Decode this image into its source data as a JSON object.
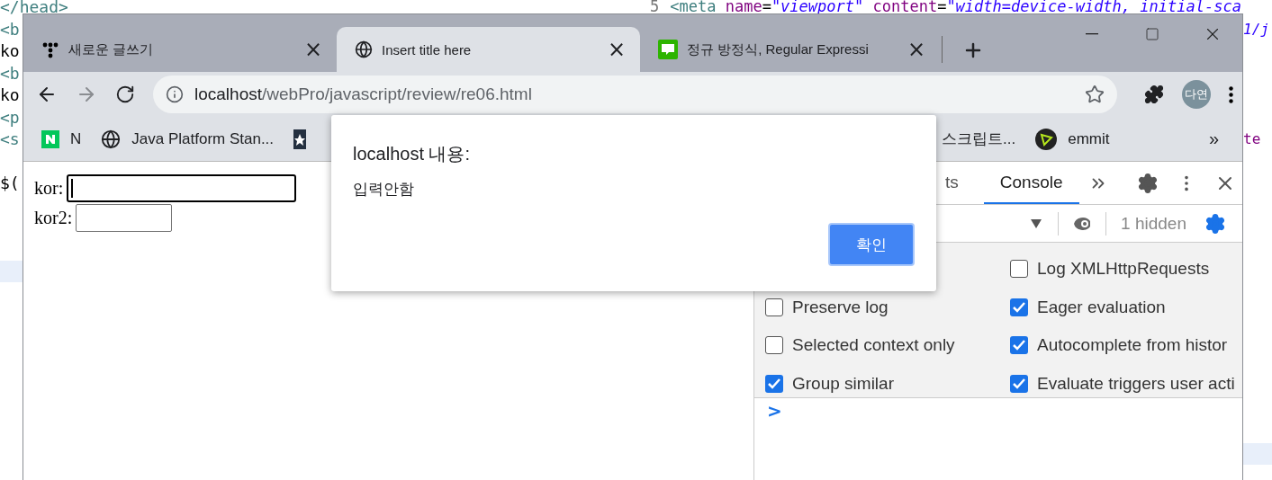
{
  "editor": {
    "left_lines": [
      {
        "kind": "tag",
        "text": "</head>"
      },
      {
        "kind": "tag",
        "text": "<b"
      },
      {
        "kind": "plain",
        "text": "ko"
      },
      {
        "kind": "tag",
        "text": "<b"
      },
      {
        "kind": "plain",
        "text": "ko"
      },
      {
        "kind": "tag",
        "text": "<p"
      },
      {
        "kind": "tag",
        "text": "<s"
      },
      {
        "kind": "blank"
      },
      {
        "kind": "plain",
        "text": "$("
      }
    ],
    "top_line": {
      "number": "5",
      "tokens": [
        {
          "kind": "tag",
          "text": "<meta"
        },
        {
          "kind": "attr",
          "text": " name"
        },
        {
          "kind": "plain",
          "text": "="
        },
        {
          "kind": "string",
          "text": "\"viewport\""
        },
        {
          "kind": "attr",
          "text": " content"
        },
        {
          "kind": "plain",
          "text": "="
        },
        {
          "kind": "string",
          "text": "\"width=device-width, initial-sca"
        }
      ]
    },
    "right_lines": [
      {
        "kind": "blank"
      },
      {
        "kind": "string",
        "text": "1/j"
      },
      {
        "kind": "blank"
      },
      {
        "kind": "blank"
      },
      {
        "kind": "blank"
      },
      {
        "kind": "blank"
      },
      {
        "kind": "attr",
        "text": "te"
      }
    ]
  },
  "browser": {
    "tabs": [
      {
        "title": "새로운 글쓰기",
        "selected": false,
        "close": "×"
      },
      {
        "title": "Insert title here",
        "selected": true,
        "close": "×"
      },
      {
        "title": "정규 방정식, Regular Expressi",
        "selected": false,
        "close": "×"
      }
    ],
    "address": {
      "host": "localhost",
      "path": "/webPro/javascript/review/re06.html"
    },
    "profile": "다연",
    "bookmarks": [
      {
        "kind": "link",
        "label": "N"
      },
      {
        "kind": "link",
        "label": "Java Platform Stan..."
      },
      {
        "kind": "icon_only"
      },
      {
        "kind": "link",
        "label": "스크립트..."
      },
      {
        "kind": "link",
        "label": "emmit"
      }
    ],
    "bookmarks_more": "»"
  },
  "page": {
    "fields": [
      {
        "label": "kor:",
        "focused": true
      },
      {
        "label": "kor2:",
        "focused": false
      }
    ]
  },
  "devtools": {
    "tabs": [
      {
        "label": "ts",
        "selected": false
      },
      {
        "label": "Console",
        "selected": true
      }
    ],
    "hidden_count": "1 hidden",
    "left_options": [
      {
        "label": "Preserve log",
        "checked": false
      },
      {
        "label": "Selected context only",
        "checked": false
      },
      {
        "label": "Group similar",
        "checked": true
      }
    ],
    "right_options": [
      {
        "label": "Log XMLHttpRequests",
        "checked": false
      },
      {
        "label": "Eager evaluation",
        "checked": true
      },
      {
        "label": "Autocomplete from histor",
        "checked": true
      },
      {
        "label": "Evaluate triggers user acti",
        "checked": true
      }
    ],
    "prompt": ">"
  },
  "dialog": {
    "title": "localhost 내용:",
    "message": "입력안함",
    "button": "확인"
  }
}
